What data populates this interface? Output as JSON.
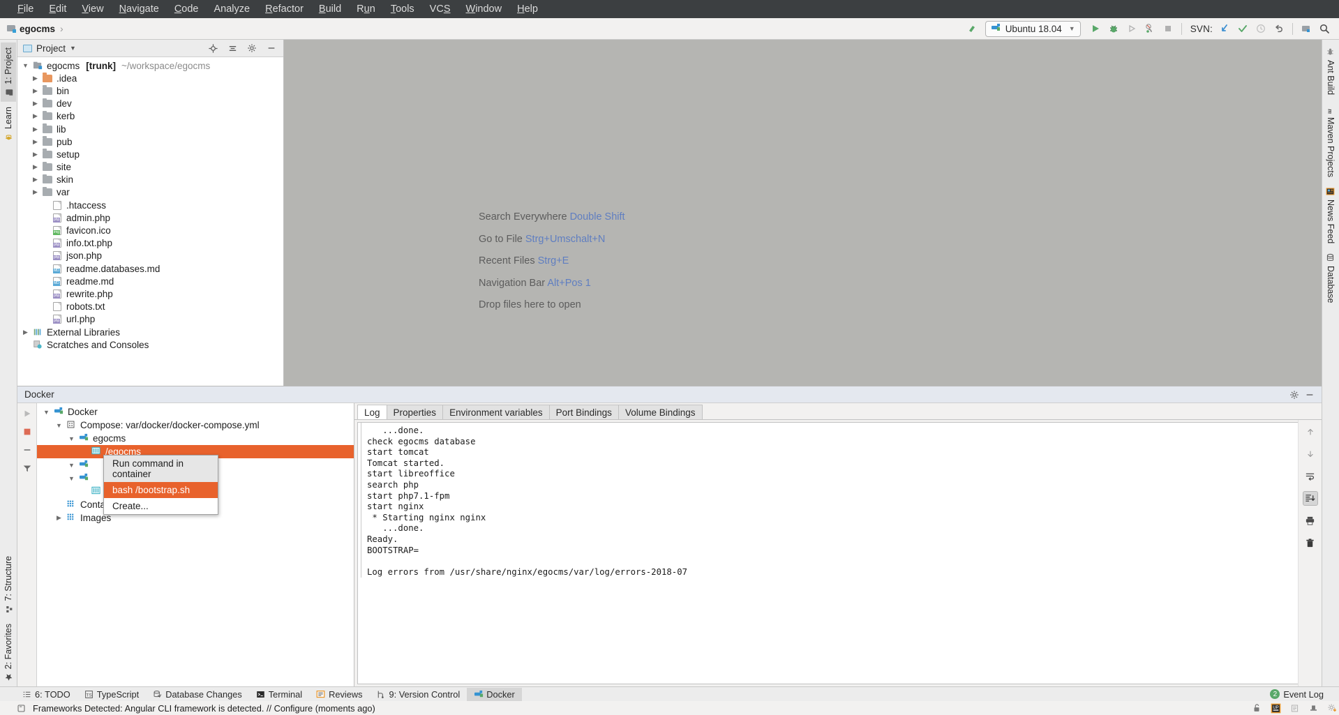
{
  "menu": {
    "items": [
      "File",
      "Edit",
      "View",
      "Navigate",
      "Code",
      "Analyze",
      "Refactor",
      "Build",
      "Run",
      "Tools",
      "VCS",
      "Window",
      "Help"
    ]
  },
  "toolbar": {
    "breadcrumb_project": "egocms",
    "breadcrumb_separator": "›",
    "run_config": "Ubuntu 18.04",
    "svn_label": "SVN:"
  },
  "left_bar": {
    "tabs_top": [
      {
        "label": "1: Project",
        "icon": "project-icon",
        "selected": true
      },
      {
        "label": "Learn",
        "icon": "learn-icon",
        "selected": false
      }
    ],
    "tabs_bottom": [
      {
        "label": "7: Structure",
        "icon": "structure-icon"
      },
      {
        "label": "2: Favorites",
        "icon": "star-icon"
      }
    ]
  },
  "right_bar": {
    "tabs": [
      {
        "label": "Ant Build",
        "icon": "ant-icon"
      },
      {
        "label": "Maven Projects",
        "icon": "maven-icon"
      },
      {
        "label": "News Feed",
        "icon": "news-icon"
      },
      {
        "label": "Database",
        "icon": "database-icon"
      }
    ]
  },
  "project_panel": {
    "title": "Project",
    "actions": [
      "target-icon",
      "collapse-all-icon",
      "settings-icon",
      "hide-icon"
    ],
    "root": {
      "name": "egocms",
      "branch": "[trunk]",
      "path": "~/workspace/egocms"
    },
    "nodes": [
      {
        "label": ".idea",
        "type": "folder",
        "color": "orange",
        "depth": 1,
        "expandable": true
      },
      {
        "label": "bin",
        "type": "folder",
        "depth": 1,
        "expandable": true
      },
      {
        "label": "dev",
        "type": "folder",
        "depth": 1,
        "expandable": true
      },
      {
        "label": "kerb",
        "type": "folder",
        "depth": 1,
        "expandable": true
      },
      {
        "label": "lib",
        "type": "folder",
        "depth": 1,
        "expandable": true
      },
      {
        "label": "pub",
        "type": "folder",
        "depth": 1,
        "expandable": true
      },
      {
        "label": "setup",
        "type": "folder",
        "depth": 1,
        "expandable": true
      },
      {
        "label": "site",
        "type": "folder",
        "depth": 1,
        "expandable": true
      },
      {
        "label": "skin",
        "type": "folder",
        "depth": 1,
        "expandable": true
      },
      {
        "label": "var",
        "type": "folder",
        "depth": 1,
        "expandable": true
      },
      {
        "label": ".htaccess",
        "type": "file",
        "badge": "",
        "badge_color": "#e8974a",
        "depth": 2
      },
      {
        "label": "admin.php",
        "type": "file",
        "badge": "php",
        "badge_color": "#9b8fc4",
        "depth": 2
      },
      {
        "label": "favicon.ico",
        "type": "file",
        "badge": "img",
        "badge_color": "#5fb85f",
        "depth": 2
      },
      {
        "label": "info.txt.php",
        "type": "file",
        "badge": "php",
        "badge_color": "#9b8fc4",
        "depth": 2
      },
      {
        "label": "json.php",
        "type": "file",
        "badge": "php",
        "badge_color": "#9b8fc4",
        "depth": 2
      },
      {
        "label": "readme.databases.md",
        "type": "file",
        "badge": "MD",
        "badge_color": "#5aa9d6",
        "depth": 2
      },
      {
        "label": "readme.md",
        "type": "file",
        "badge": "MD",
        "badge_color": "#5aa9d6",
        "depth": 2
      },
      {
        "label": "rewrite.php",
        "type": "file",
        "badge": "php",
        "badge_color": "#9b8fc4",
        "depth": 2
      },
      {
        "label": "robots.txt",
        "type": "file",
        "badge": "",
        "badge_color": "#a0a0a0",
        "depth": 2
      },
      {
        "label": "url.php",
        "type": "file",
        "badge": "php",
        "badge_color": "#9b8fc4",
        "depth": 2
      },
      {
        "label": "External Libraries",
        "type": "libs",
        "depth": 0,
        "expandable": true
      },
      {
        "label": "Scratches and Consoles",
        "type": "scratches",
        "depth": 0
      }
    ]
  },
  "editor": {
    "hints": [
      {
        "action": "Search Everywhere",
        "shortcut": "Double Shift"
      },
      {
        "action": "Go to File",
        "shortcut": "Strg+Umschalt+N"
      },
      {
        "action": "Recent Files",
        "shortcut": "Strg+E"
      },
      {
        "action": "Navigation Bar",
        "shortcut": "Alt+Pos 1"
      },
      {
        "action": "Drop files here to open",
        "shortcut": ""
      }
    ]
  },
  "docker_panel": {
    "title": "Docker",
    "side_actions": [
      "run-icon",
      "stop-icon",
      "collapse-icon",
      "filter-icon"
    ],
    "tree": [
      {
        "label": "Docker",
        "depth": 0,
        "icon": "docker-icon",
        "expanded": true
      },
      {
        "label": "Compose: var/docker/docker-compose.yml",
        "depth": 1,
        "icon": "compose-icon",
        "expanded": true
      },
      {
        "label": "egocms",
        "depth": 2,
        "icon": "docker-icon",
        "expanded": true
      },
      {
        "label": "/egocms",
        "depth": 3,
        "icon": "container-icon",
        "selected": true
      },
      {
        "label": "",
        "depth": 2,
        "icon": "docker-icon",
        "expanded": true
      },
      {
        "label": "",
        "depth": 2,
        "icon": "docker-icon",
        "expanded": true
      },
      {
        "label": "/saml",
        "depth": 3,
        "icon": "container-icon"
      },
      {
        "label": "Containers",
        "depth": 1,
        "icon": "grid-icon"
      },
      {
        "label": "Images",
        "depth": 1,
        "icon": "grid-icon",
        "expandable": true
      }
    ],
    "popup": {
      "header": "Run command in container",
      "items": [
        {
          "label": "bash /bootstrap.sh",
          "highlighted": true
        },
        {
          "label": "Create...",
          "highlighted": false
        }
      ]
    },
    "tabs": [
      {
        "label": "Log",
        "active": true
      },
      {
        "label": "Properties",
        "active": false
      },
      {
        "label": "Environment variables",
        "active": false
      },
      {
        "label": "Port Bindings",
        "active": false
      },
      {
        "label": "Volume Bindings",
        "active": false
      }
    ],
    "log_lines": [
      "   ...done.",
      "check egocms database",
      "start tomcat",
      "Tomcat started.",
      "start libreoffice",
      "search php",
      "start php7.1-fpm",
      "start nginx",
      " * Starting nginx nginx",
      "   ...done.",
      "Ready.",
      "BOOTSTRAP=",
      "",
      "Log errors from /usr/share/nginx/egocms/var/log/errors-2018-07"
    ],
    "log_actions": [
      "scroll-up-icon",
      "scroll-down-icon",
      "soft-wrap-icon",
      "scroll-to-end-icon",
      "print-icon",
      "clear-icon"
    ]
  },
  "bottom_bar": {
    "buttons": [
      {
        "label": "6: TODO",
        "icon": "todo-icon",
        "active": false
      },
      {
        "label": "TypeScript",
        "icon": "typescript-icon",
        "active": false
      },
      {
        "label": "Database Changes",
        "icon": "db-changes-icon",
        "active": false
      },
      {
        "label": "Terminal",
        "icon": "terminal-icon",
        "active": false
      },
      {
        "label": "Reviews",
        "icon": "reviews-icon",
        "active": false
      },
      {
        "label": "9: Version Control",
        "icon": "vcs-icon",
        "active": false
      },
      {
        "label": "Docker",
        "icon": "docker-icon",
        "active": true
      }
    ],
    "event_log": {
      "label": "Event Log",
      "count": "2"
    }
  },
  "status_bar": {
    "message": "Frameworks Detected: Angular CLI framework is detected. // Configure (moments ago)",
    "icons": [
      "lock-icon",
      "up-icon",
      "memory-icon",
      "hat-icon",
      "gear-download-icon"
    ]
  },
  "colors": {
    "accent_orange": "#e8622c",
    "link_blue": "#5f7ec1",
    "menu_bg": "#3c3f41",
    "editor_bg": "#b5b5b2"
  }
}
